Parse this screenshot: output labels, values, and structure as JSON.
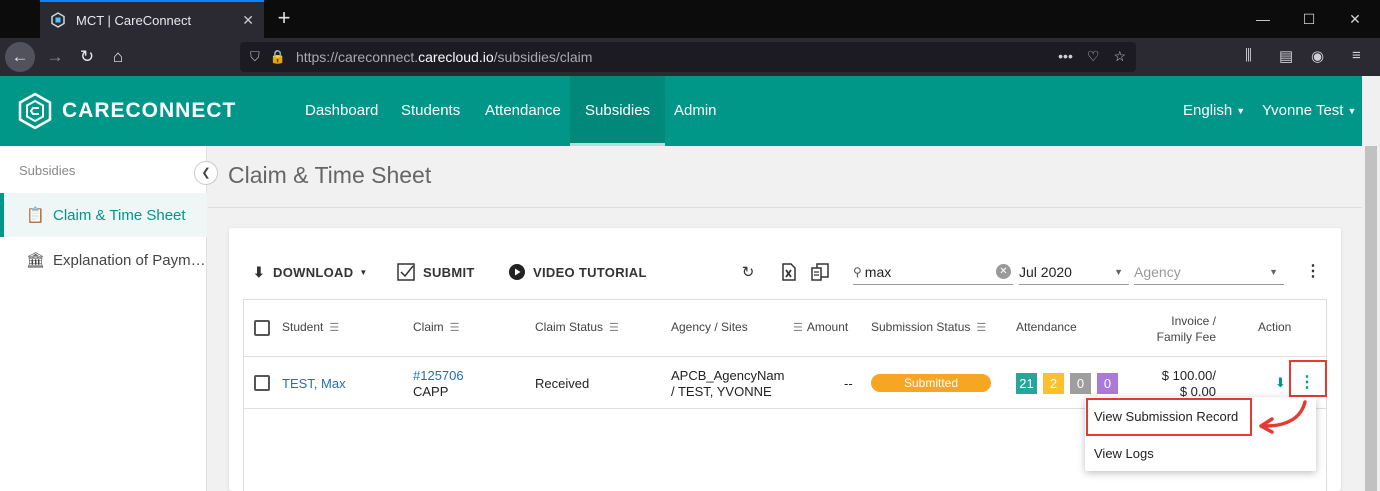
{
  "browser": {
    "tab_title": "MCT | CareConnect",
    "url_prefix": "https://careconnect.",
    "url_domain": "carecloud.io",
    "url_path": "/subsidies/claim"
  },
  "app": {
    "brand": "CARECONNECT",
    "nav": [
      "Dashboard",
      "Students",
      "Attendance",
      "Subsidies",
      "Admin"
    ],
    "active_nav": "Subsidies",
    "language": "English",
    "user": "Yvonne Test"
  },
  "sidebar": {
    "heading": "Subsidies",
    "items": [
      {
        "label": "Claim & Time Sheet",
        "icon": "clipboard-icon",
        "active": true
      },
      {
        "label": "Explanation of Paym…",
        "icon": "building-icon",
        "active": false
      }
    ]
  },
  "page": {
    "title": "Claim & Time Sheet"
  },
  "toolbar": {
    "download": "DOWNLOAD",
    "submit": "SUBMIT",
    "video": "VIDEO TUTORIAL",
    "search_value": "max",
    "month_value": "Jul 2020",
    "agency_placeholder": "Agency"
  },
  "table": {
    "headers": {
      "student": "Student",
      "claim": "Claim",
      "claim_status": "Claim Status",
      "agency": "Agency / Sites",
      "amount": "Amount",
      "submission_status": "Submission Status",
      "attendance": "Attendance",
      "invoice_line1": "Invoice /",
      "invoice_line2": "Family Fee",
      "action": "Action"
    },
    "rows": [
      {
        "student": "TEST, Max",
        "claim_id": "#125706",
        "claim_type": "CAPP",
        "claim_status": "Received",
        "agency_line1": "APCB_AgencyNam",
        "agency_line2": "/ TEST, YVONNE",
        "amount": "--",
        "submission_status": "Submitted",
        "attendance": [
          {
            "value": "21",
            "color": "#26a69a"
          },
          {
            "value": "2",
            "color": "#fbc02d"
          },
          {
            "value": "0",
            "color": "#9e9e9e"
          },
          {
            "value": "0",
            "color": "#ab7ad6"
          }
        ],
        "invoice_line1": "$ 100.00/",
        "invoice_line2": "$ 0.00"
      }
    ]
  },
  "context_menu": {
    "items": [
      "View Submission Record",
      "View Logs"
    ]
  },
  "colors": {
    "brand": "#009688",
    "highlight": "#e53935",
    "badge_submitted": "#f6a623"
  }
}
